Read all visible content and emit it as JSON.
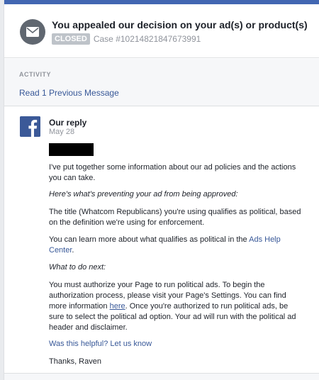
{
  "header": {
    "title": "You appealed our decision on your ad(s) or product(s)",
    "status_badge": "CLOSED",
    "case_number": "Case #10214821847673991"
  },
  "activity": {
    "label": "ACTIVITY",
    "read_previous": "Read 1 Previous Message"
  },
  "message": {
    "author": "Our reply",
    "date": "May 28",
    "p1": "I've put together some information about our ad policies and the actions you can take.",
    "p2": "Here's what's preventing your ad from being approved:",
    "p3": "The title (Whatcom Republicans) you're using qualifies as political, based on the definition we're using for enforcement.",
    "p4_pre": "You can learn more about what qualifies as political in the ",
    "p4_link": "Ads Help Center",
    "p4_post": ".",
    "p5": "What to do next:",
    "p6_pre": "You must authorize your Page to run political ads. To begin the authorization process, please visit your Page's Settings. You can find more information ",
    "p6_link": "here",
    "p6_post": ". Once you're authorized to run political ads, be sure to select the political ad option. Your ad will run with the political ad header and disclaimer.",
    "helpful_link": "Was this helpful? Let us know",
    "signoff": "Thanks, Raven"
  },
  "icons": {
    "status_icon": "envelope-icon",
    "sender_icon": "facebook-logo-icon"
  },
  "colors": {
    "link": "#385898",
    "brand": "#3b5998",
    "topbar": "#4267b2",
    "badge": "#bec3c9"
  }
}
